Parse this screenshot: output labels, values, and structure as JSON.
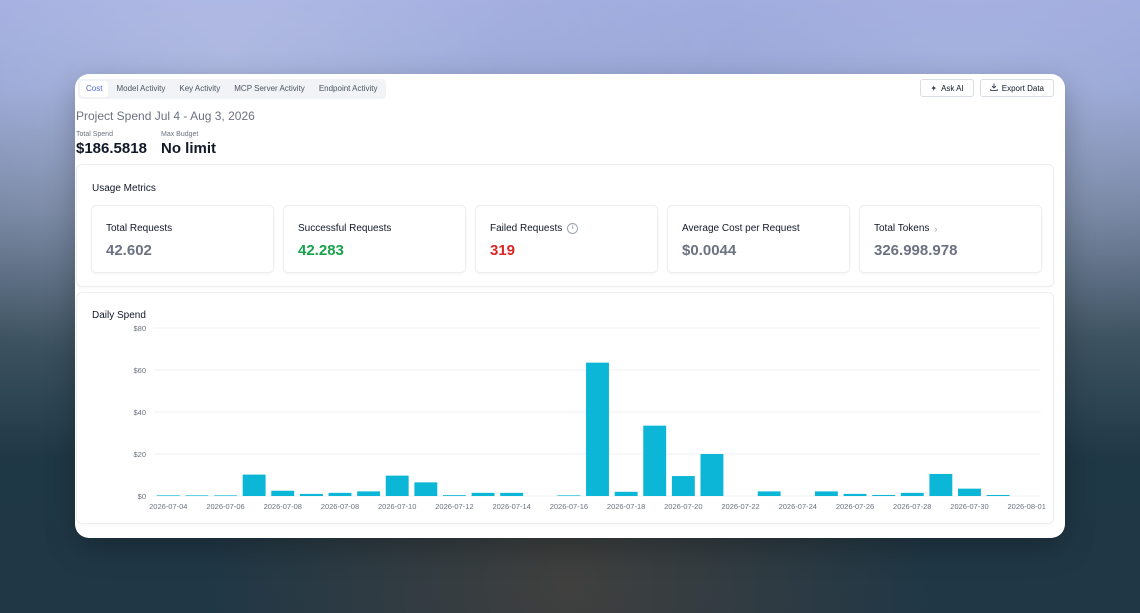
{
  "tabs": [
    {
      "label": "Cost",
      "active": true
    },
    {
      "label": "Model Activity",
      "active": false
    },
    {
      "label": "Key Activity",
      "active": false
    },
    {
      "label": "MCP Server Activity",
      "active": false
    },
    {
      "label": "Endpoint Activity",
      "active": false
    }
  ],
  "actions": {
    "ask_ai_label": "Ask AI",
    "ask_ai_icon": "sparkle-icon",
    "export_label": "Export Data",
    "export_icon": "download-icon"
  },
  "project_title": "Project Spend Jul 4 - Aug 3, 2026",
  "summary": {
    "total_spend_label": "Total Spend",
    "total_spend_value": "$186.5818",
    "max_budget_label": "Max Budget",
    "max_budget_value": "No limit"
  },
  "usage_metrics": {
    "title": "Usage Metrics",
    "cards": [
      {
        "label": "Total Requests",
        "value": "42.602",
        "color": "#6b7280"
      },
      {
        "label": "Successful Requests",
        "value": "42.283",
        "color": "#16a34a"
      },
      {
        "label": "Failed Requests",
        "value": "319",
        "color": "#dc2626",
        "icon": "info-icon"
      },
      {
        "label": "Average Cost per Request",
        "value": "$0.0044",
        "color": "#6b7280"
      },
      {
        "label": "Total Tokens",
        "value": "326.998.978",
        "color": "#6b7280",
        "icon": "chevron-right-icon"
      }
    ]
  },
  "daily_spend": {
    "title": "Daily Spend"
  },
  "chart_data": {
    "type": "bar",
    "title": "Daily Spend",
    "bar_color": "#0bb6d6",
    "ylim": [
      0,
      80
    ],
    "y_ticks": [
      "$0",
      "$20",
      "$40",
      "$60",
      "$80"
    ],
    "categories": [
      "2026-07-04",
      "2026-07-05",
      "2026-07-06",
      "2026-07-07",
      "2026-07-08",
      "2026-07-09",
      "2026-07-10",
      "2026-07-11",
      "2026-07-12",
      "2026-07-13",
      "2026-07-14",
      "2026-07-15",
      "2026-07-16",
      "2026-07-17",
      "2026-07-18",
      "2026-07-19",
      "2026-07-20",
      "2026-07-21",
      "2026-07-22",
      "2026-07-23",
      "2026-07-24",
      "2026-07-25",
      "2026-07-26",
      "2026-07-27",
      "2026-07-28",
      "2026-07-29",
      "2026-07-30",
      "2026-07-31",
      "2026-08-01",
      "2026-08-02",
      "2026-08-03"
    ],
    "x_tick_labels": [
      "2026-07-04",
      "2026-07-06",
      "2026-07-08",
      "2026-07-08",
      "2026-07-10",
      "2026-07-12",
      "2026-07-14",
      "2026-07-16",
      "2026-07-18",
      "2026-07-20",
      "2026-07-22",
      "2026-07-24",
      "2026-07-26",
      "2026-07-28",
      "2026-07-30",
      "2026-08-01",
      "2026-08-03"
    ],
    "values": [
      0.3,
      0.3,
      0.3,
      10.2,
      2.5,
      1.0,
      1.5,
      2.2,
      9.7,
      6.5,
      0.4,
      1.5,
      1.5,
      0,
      0.3,
      63.5,
      2.0,
      33.5,
      9.5,
      20.0,
      0,
      2.2,
      0,
      2.2,
      1.0,
      0.5,
      1.5,
      10.5,
      3.5,
      0.5,
      0
    ]
  }
}
